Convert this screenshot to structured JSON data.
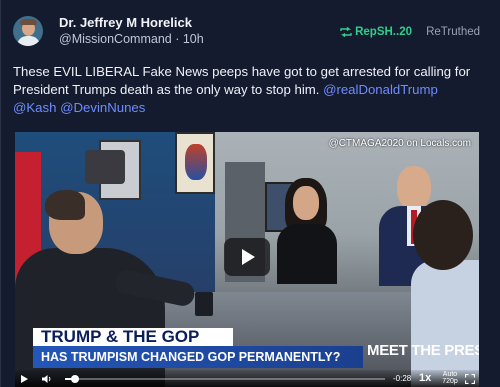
{
  "post": {
    "author_name": "Dr. Jeffrey M Horelick",
    "handle": "@MissionCommand",
    "separator": " · ",
    "time": "10h",
    "retruth_by": "RepSH..20",
    "retruth_status": "ReTruthed",
    "text_main": "These EVIL LIBERAL Fake News peeps have got to get arrested for calling for President Trumps death as the only way to stop him. ",
    "mentions": [
      "@realDonaldTrump",
      "@Kash",
      "@DevinNunes"
    ]
  },
  "video": {
    "watermark": "@CTMAGA2020 on Locals.com",
    "lower_third_title": "TRUMP & THE GOP",
    "lower_third_subtitle": "HAS TRUMPISM CHANGED GOP PERMANENTLY?",
    "show_logo": "MEET THE PRESS",
    "time_remaining": "-0:28",
    "speed": "1x",
    "quality_line1": "Auto",
    "quality_line2": "720p",
    "progress_fraction": 0.03
  },
  "colors": {
    "background": "#151b2e",
    "accent_green": "#2fd08a",
    "mention_blue": "#6d8cff"
  },
  "icons": {
    "retruth": "retruth-arrows-icon",
    "play": "play-icon",
    "volume": "volume-icon",
    "fullscreen": "fullscreen-icon"
  }
}
